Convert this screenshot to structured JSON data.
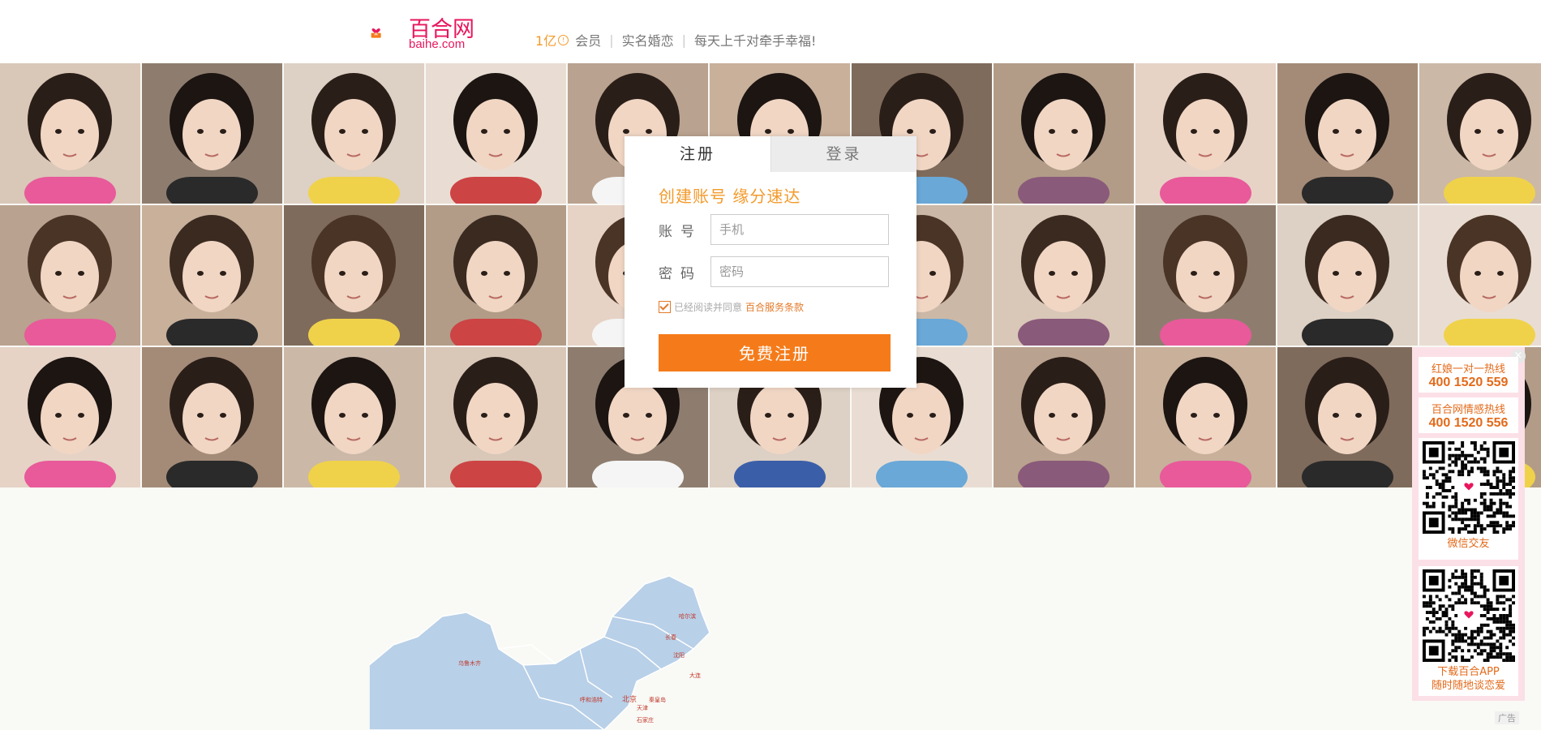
{
  "header": {
    "logo_name": "百合网",
    "logo_domain": "baihe.com",
    "member_count": "1亿",
    "member_label": "会员",
    "tag1": "实名婚恋",
    "tag2": "每天上千对牵手幸福!",
    "separator": "|"
  },
  "register_panel": {
    "tab_register": "注册",
    "tab_login": "登录",
    "title": "创建账号  缘分速达",
    "account_label": "账号",
    "account_placeholder": "手机",
    "password_label": "密码",
    "password_placeholder": "密码",
    "agree_text": "已经阅读并同意",
    "terms_link": "百合服务条款",
    "submit_label": "免费注册"
  },
  "sidebar": {
    "close_symbol": "×",
    "hotline1_title": "红娘一对一热线",
    "hotline1_number": "400 1520 559",
    "hotline2_title": "百合网情感热线",
    "hotline2_number": "400 1520 556",
    "qr1_caption": "微信交友",
    "qr2_caption_line1": "下载百合APP",
    "qr2_caption_line2": "随时随地谈恋爱"
  },
  "ad_label": "广告",
  "map_labels": [
    "北京",
    "天津",
    "沈阳",
    "长春",
    "哈尔滨",
    "大连",
    "呼和浩特",
    "石家庄",
    "秦皇岛",
    "乌鲁木齐"
  ]
}
